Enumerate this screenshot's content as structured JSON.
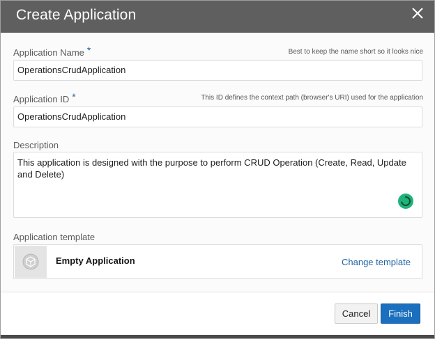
{
  "dialog": {
    "title": "Create Application",
    "close_icon": "close-icon"
  },
  "form": {
    "app_name": {
      "label": "Application Name",
      "required_mark": "*",
      "hint": "Best to keep the name short so it looks nice",
      "value": "OperationsCrudApplication"
    },
    "app_id": {
      "label": "Application ID",
      "required_mark": "*",
      "hint": "This ID defines the context path (browser's URI) used for the application",
      "value": "OperationsCrudApplication"
    },
    "description": {
      "label": "Description",
      "value": "This application is designed with the purpose to perform CRUD Operation (Create, Read, Update and Delete)"
    },
    "template": {
      "label": "Application template",
      "name": "Empty Application",
      "change_label": "Change template",
      "icon": "cube-icon"
    }
  },
  "footer": {
    "cancel_label": "Cancel",
    "finish_label": "Finish"
  },
  "colors": {
    "header_bg": "#5f5f5f",
    "primary": "#1b6fbf",
    "link": "#1f64a4",
    "spinner": "#20b27a"
  }
}
